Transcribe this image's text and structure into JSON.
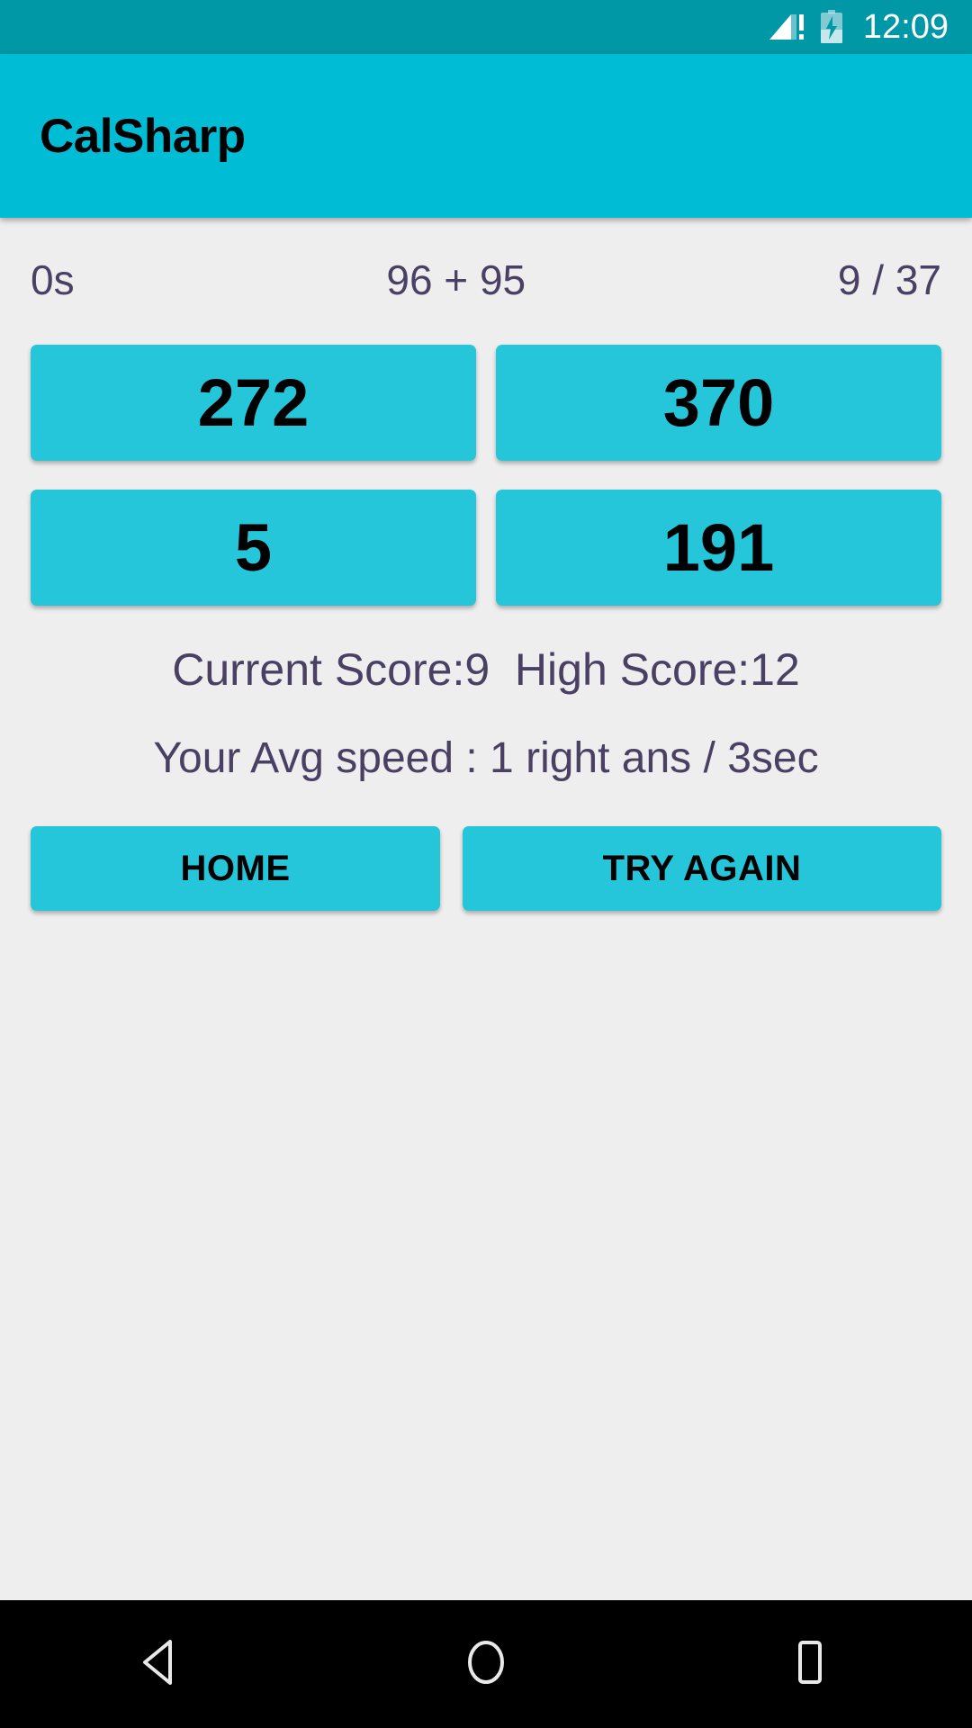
{
  "status_bar": {
    "clock": "12:09",
    "signal_icon": "signal-no-service-icon",
    "battery_icon": "battery-charging-icon",
    "background_color": "#0097a7"
  },
  "app_bar": {
    "title": "CalSharp",
    "background_color": "#00bcd4",
    "title_color": "#000000"
  },
  "game": {
    "timer": "0s",
    "question": "96 + 95",
    "progress": "9 / 37",
    "answers": [
      [
        "272",
        "370"
      ],
      [
        "5",
        "191"
      ]
    ],
    "score_line": "Current Score:9  High Score:12",
    "speed_line": "Your Avg speed : 1 right ans / 3sec",
    "button_color": "#26c6da",
    "text_color": "#4a4063"
  },
  "actions": {
    "home_label": "HOME",
    "try_again_label": "TRY AGAIN"
  },
  "nav_bar": {
    "back_icon": "back-triangle-icon",
    "home_icon": "home-circle-icon",
    "recents_icon": "recents-square-icon",
    "background_color": "#000000"
  }
}
